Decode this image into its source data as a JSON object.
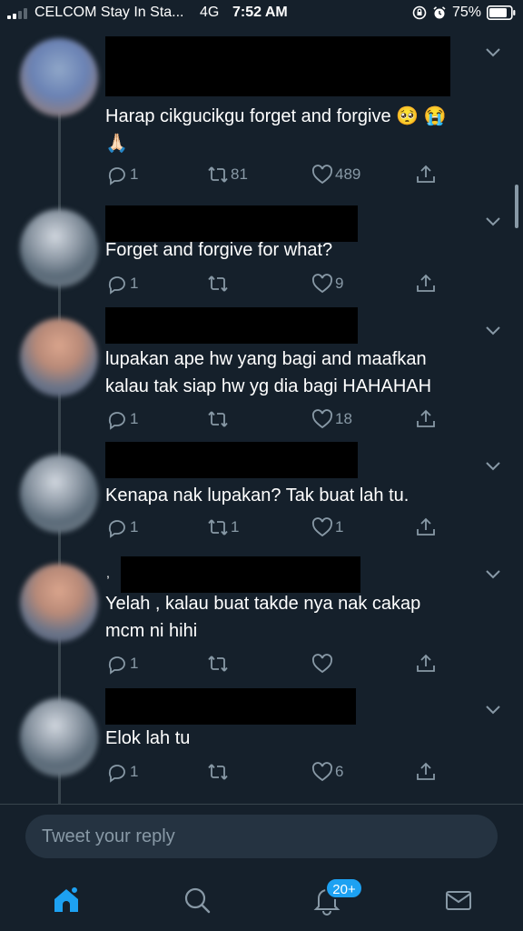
{
  "status_bar": {
    "carrier": "CELCOM Stay In Sta...",
    "network": "4G",
    "time": "7:52 AM",
    "battery": "75%"
  },
  "tweets": [
    {
      "text": "Harap cikgucikgu forget and forgive 🥺 😭\n🙏🏻",
      "replies": "1",
      "retweets": "81",
      "likes": "489"
    },
    {
      "text": "Forget and forgive for what?",
      "replies": "1",
      "retweets": "",
      "likes": "9"
    },
    {
      "text": "lupakan ape hw yang bagi and maafkan\nkalau tak siap hw yg dia bagi HAHAHAH",
      "replies": "1",
      "retweets": "",
      "likes": "18"
    },
    {
      "text": "Kenapa nak lupakan? Tak buat lah tu.",
      "replies": "1",
      "retweets": "1",
      "likes": "1"
    },
    {
      "text": "Yelah , kalau buat takde nya nak cakap\nmcm ni hihi",
      "replies": "1",
      "retweets": "",
      "likes": ""
    },
    {
      "text": "Elok lah tu",
      "replies": "1",
      "retweets": "",
      "likes": "6"
    }
  ],
  "mark": ",",
  "reply_input": {
    "placeholder": "Tweet your reply"
  },
  "tabbar": {
    "notifications_badge": "20+"
  },
  "colors": {
    "background": "#15202b",
    "accent": "#1da1f2",
    "muted": "#8899a6"
  },
  "icons": [
    "reply-icon",
    "retweet-icon",
    "like-icon",
    "share-icon",
    "home-icon",
    "search-icon",
    "bell-icon",
    "mail-icon"
  ]
}
